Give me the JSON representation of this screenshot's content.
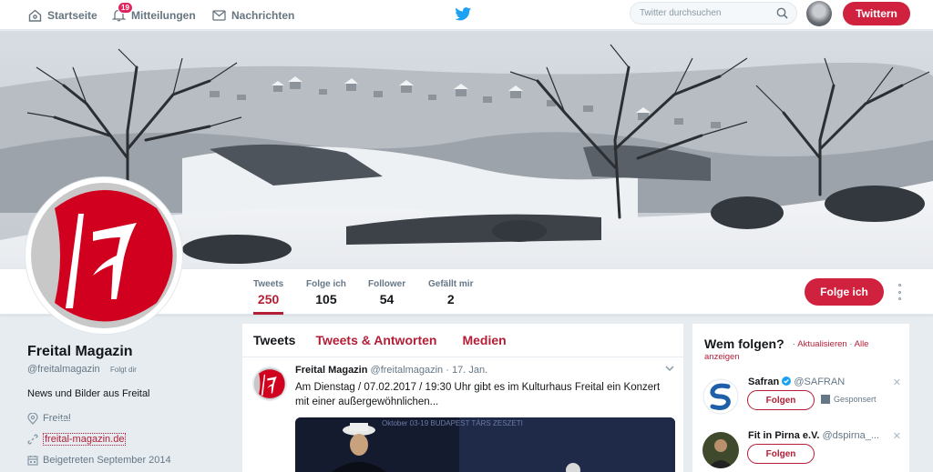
{
  "nav": {
    "home": "Startseite",
    "notifications": "Mitteilungen",
    "notifications_count": "19",
    "messages": "Nachrichten",
    "search_placeholder": "Twitter durchsuchen",
    "tweet_button": "Twittern"
  },
  "profile": {
    "stats": [
      {
        "label": "Tweets",
        "value": "250"
      },
      {
        "label": "Folge ich",
        "value": "105"
      },
      {
        "label": "Follower",
        "value": "54"
      },
      {
        "label": "Gefällt mir",
        "value": "2"
      }
    ],
    "follow_button": "Folge ich",
    "name": "Freital Magazin",
    "handle": "@freitalmagazin",
    "follows_you": "Folgt dir",
    "bio": "News und Bilder aus Freital",
    "location": "Freital",
    "website": "freital-magazin.de",
    "joined": "Beigetreten September 2014"
  },
  "timeline": {
    "tabs": [
      "Tweets",
      "Tweets & Antworten",
      "Medien"
    ],
    "tweet": {
      "name": "Freital Magazin",
      "handle": "@freitalmagazin",
      "dot": "·",
      "date": "17. Jan.",
      "text": "Am Dienstag / 07.02.2017 / 19:30 Uhr gibt es im Kulturhaus Freital ein Konzert mit einer außergewöhnlichen...",
      "media_text": "Oktober 03-19 BUDAPEST TÁRS ZESZETI"
    }
  },
  "who_to_follow": {
    "title": "Wem folgen?",
    "dot": "·",
    "refresh": "Aktualisieren",
    "show_all": "Alle anzeigen",
    "suggestions": [
      {
        "name": "Safran",
        "handle": "@SAFRAN",
        "button": "Folgen",
        "sponsored": "Gesponsert"
      },
      {
        "name": "Fit in Pirna e.V.",
        "handle": "@dspirna_...",
        "button": "Folgen"
      }
    ]
  },
  "colors": {
    "accent": "#b31e36",
    "button": "#d0223f",
    "twitter_blue": "#1da1f2"
  }
}
